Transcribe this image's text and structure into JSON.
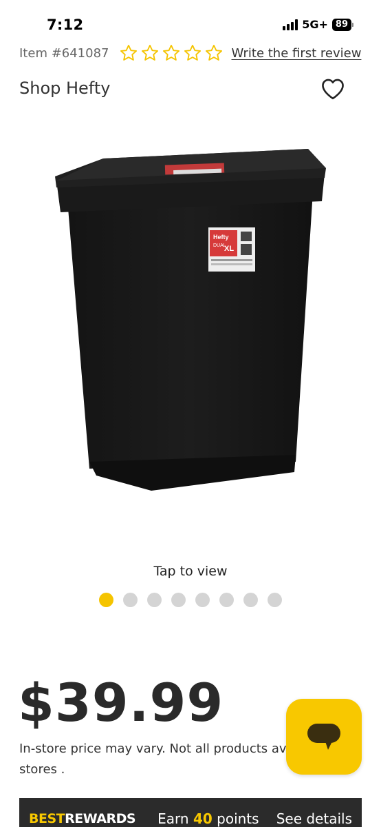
{
  "status_bar": {
    "time": "7:12",
    "network": "5G+",
    "battery": "89"
  },
  "product": {
    "item_number": "Item #641087",
    "rating_stars": 0,
    "review_link": "Write the first review",
    "brand_link": "Shop Hefty",
    "image_label_brand": "Hefty",
    "image_label_line1": "DUAL",
    "image_label_line2": "XL"
  },
  "gallery": {
    "tap_label": "Tap to view",
    "dot_count": 8,
    "active_index": 0
  },
  "pricing": {
    "price": "$39.99",
    "note": "In-store price may vary. Not all products av",
    "note_line2": "stores ."
  },
  "rewards": {
    "logo_best": "BEST",
    "logo_rewards": "REWARDS",
    "earn_prefix": "Earn",
    "points": "40",
    "earn_suffix": "points",
    "details": "See details"
  },
  "colors": {
    "accent": "#f8c800",
    "dark": "#2b2b2b",
    "dot_inactive": "#d4d4d4"
  },
  "icons": {
    "favorite": "heart-outline-icon",
    "chat": "chat-bubble-icon",
    "rating": "star-outline-icon"
  }
}
